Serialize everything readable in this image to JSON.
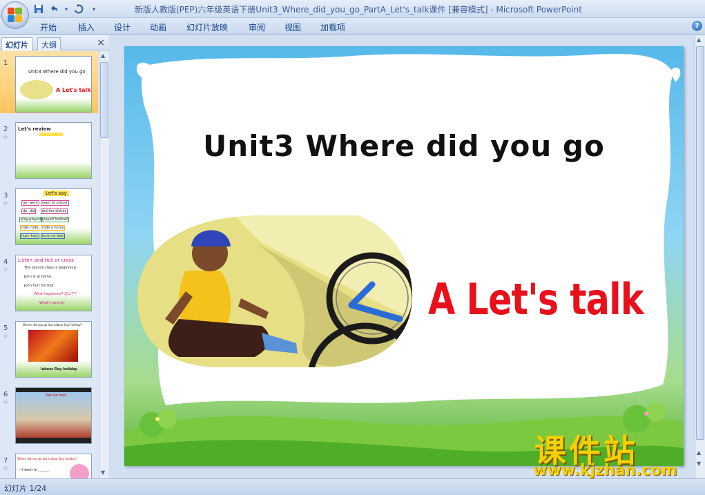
{
  "window": {
    "title": "新版人教版(PEP)六年级英语下册Unit3_Where_did_you_go_PartA_Let's_talk课件 [兼容模式]",
    "separator": " - ",
    "app_name": "Microsoft PowerPoint"
  },
  "quick_access": {
    "icons": [
      "save-icon",
      "undo-icon",
      "redo-icon",
      "customize-icon"
    ]
  },
  "ribbon_tabs": [
    "开始",
    "插入",
    "设计",
    "动画",
    "幻灯片放映",
    "审阅",
    "视图",
    "加载项"
  ],
  "left_pane": {
    "tabs": [
      "幻灯片",
      "大纲"
    ],
    "close_glyph": "×",
    "thumbnails": [
      {
        "number": "1",
        "lines": [
          "Unit3 Where did you go",
          "A Let's talk"
        ]
      },
      {
        "number": "2",
        "lines": [
          "Let's review"
        ]
      },
      {
        "number": "3",
        "lines": [
          "Let's say",
          "go- went",
          "want to school",
          "do- did",
          "did the dishes",
          "play-played",
          "played football",
          "ride- rode",
          "rode a horse",
          "hurt- hurt",
          "hurt my foot"
        ]
      },
      {
        "number": "4",
        "lines": [
          "Listen and tick or cross",
          "The second class is beginning.",
          "John is at home.",
          "John hurt his foot.",
          "What happened? 怎么了?",
          "What's wrong?"
        ]
      },
      {
        "number": "5",
        "lines": [
          "Where did you go last Labour Day holiday?",
          "labour Day holiday"
        ]
      },
      {
        "number": "6",
        "lines": [
          "Tian An men"
        ]
      },
      {
        "number": "7",
        "lines": [
          "Where did you go last Labour Day holiday?",
          "—I went to ______."
        ]
      }
    ]
  },
  "slide": {
    "title": "Unit3 Where did you go",
    "subtitle": "A Let's talk"
  },
  "status_bar": {
    "slide_counter": "幻灯片 1/24"
  },
  "watermark": {
    "chinese": "课件站",
    "url": "www.kjzhan.com"
  },
  "colors": {
    "title_text": "#111111",
    "subtitle_text": "#e8101a",
    "selected_thumb": "#ffc45c",
    "watermark": "#f5d000"
  }
}
